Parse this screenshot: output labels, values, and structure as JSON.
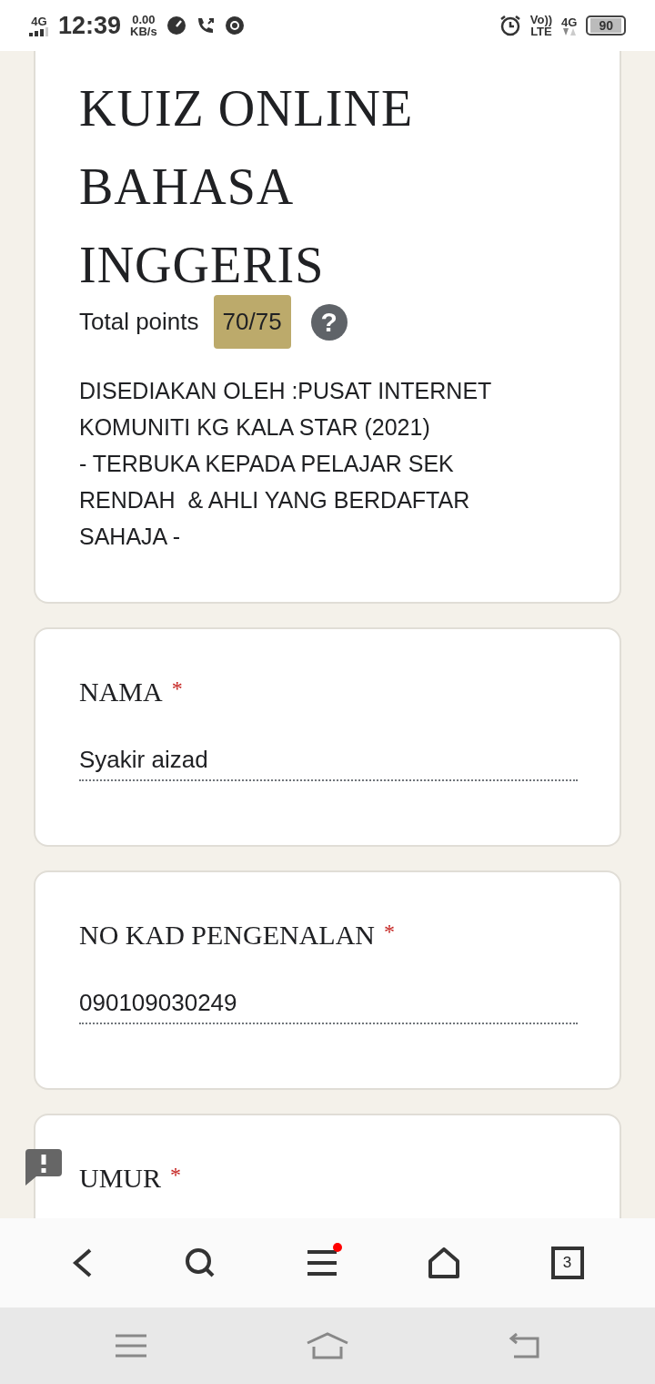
{
  "status_bar": {
    "network": "4G",
    "time": "12:39",
    "speed": "0.00",
    "speed_unit": "KB/s",
    "volte": "Vo))",
    "lte": "LTE",
    "data_network": "4G",
    "battery": "90"
  },
  "header": {
    "title": "KUIZ ONLINE BAHASA INGGERIS",
    "points_label": "Total points",
    "score": "70/75",
    "help": "?",
    "description": "DISEDIAKAN OLEH :PUSAT INTERNET KOMUNITI KG KALA STAR (2021)\n- TERBUKA KEPADA PELAJAR SEK RENDAH  & AHLI YANG BERDAFTAR SAHAJA -"
  },
  "required_mark": "*",
  "questions": [
    {
      "label": "NAMA",
      "required": true,
      "value": "Syakir aizad"
    },
    {
      "label": "NO KAD PENGENALAN",
      "required": true,
      "value": "090109030249"
    },
    {
      "label": "UMUR",
      "required": true
    }
  ],
  "toolbar": {
    "menu_badge": true,
    "tab_count": "3"
  }
}
